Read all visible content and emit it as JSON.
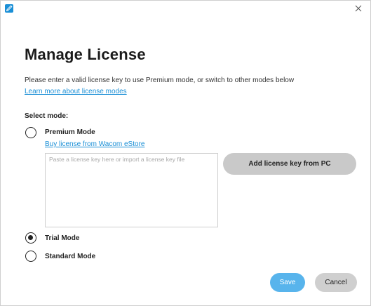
{
  "window": {
    "app_icon": "pen-icon",
    "close_icon": "close-icon"
  },
  "header": {
    "title": "Manage License",
    "description": "Please enter a valid license key to use Premium mode, or switch to other modes below",
    "learn_more_link": "Learn more about license modes"
  },
  "mode_selection": {
    "label": "Select mode:",
    "selected": "trial",
    "options": [
      {
        "id": "premium",
        "label": "Premium Mode",
        "checked": false
      },
      {
        "id": "trial",
        "label": "Trial Mode",
        "checked": true
      },
      {
        "id": "standard",
        "label": "Standard Mode",
        "checked": false
      }
    ]
  },
  "premium": {
    "buy_link": "Buy license from Wacom eStore",
    "license_input_placeholder": "Paste a license key here or import a license key file",
    "license_input_value": "",
    "add_key_button": "Add license key from PC"
  },
  "footer": {
    "save_label": "Save",
    "cancel_label": "Cancel"
  },
  "colors": {
    "accent": "#1a8fd6",
    "save_button": "#58b4ec",
    "secondary_button": "#c9c9c9"
  }
}
